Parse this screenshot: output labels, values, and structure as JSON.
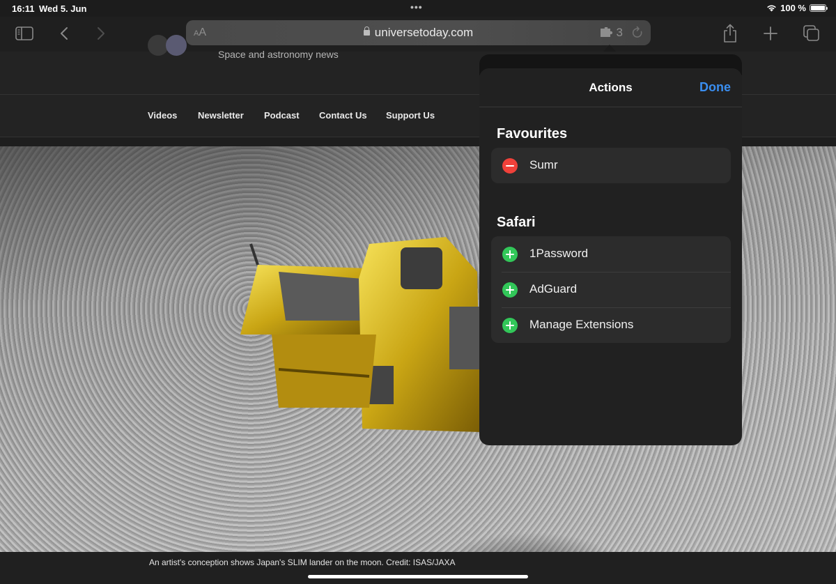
{
  "status_bar": {
    "time": "16:11",
    "date": "Wed 5. Jun",
    "battery_text": "100 %",
    "battery_level": 1.0,
    "wifi_icon": "wifi-icon",
    "multitasking_dots": "•••"
  },
  "toolbar": {
    "icons": [
      "sidebar-icon",
      "back-icon",
      "forward-icon",
      "share-icon",
      "new-tab-icon",
      "tabs-icon"
    ],
    "url_bar": {
      "reader_label_small": "A",
      "reader_label_large": "A",
      "lock_icon": "lock-icon",
      "url": "universetoday.com",
      "extension_icon": "puzzle-piece-icon",
      "extension_count": "3",
      "reload_icon": "reload-icon"
    }
  },
  "site": {
    "tagline": "Space and astronomy news",
    "nav": [
      "Videos",
      "Newsletter",
      "Podcast",
      "Contact Us",
      "Support Us"
    ],
    "hero_alt": "Artist's conception of the SLIM lander on the moon",
    "caption": "An artist's conception shows Japan's SLIM lander on the moon. Credit: ISAS/JAXA"
  },
  "actions_popover": {
    "title": "Actions",
    "done_label": "Done",
    "sections": [
      {
        "title": "Favourites",
        "items": [
          {
            "label": "Sumr",
            "action": "remove",
            "icon": "remove-circle-icon"
          }
        ]
      },
      {
        "title": "Safari",
        "items": [
          {
            "label": "1Password",
            "action": "add",
            "icon": "add-circle-icon"
          },
          {
            "label": "AdGuard",
            "action": "add",
            "icon": "add-circle-icon"
          },
          {
            "label": "Manage Extensions",
            "action": "add",
            "icon": "add-circle-icon"
          }
        ]
      }
    ]
  },
  "colors": {
    "accent_blue": "#3a8ef0",
    "remove_red": "#f0413a",
    "add_green": "#32c759"
  }
}
